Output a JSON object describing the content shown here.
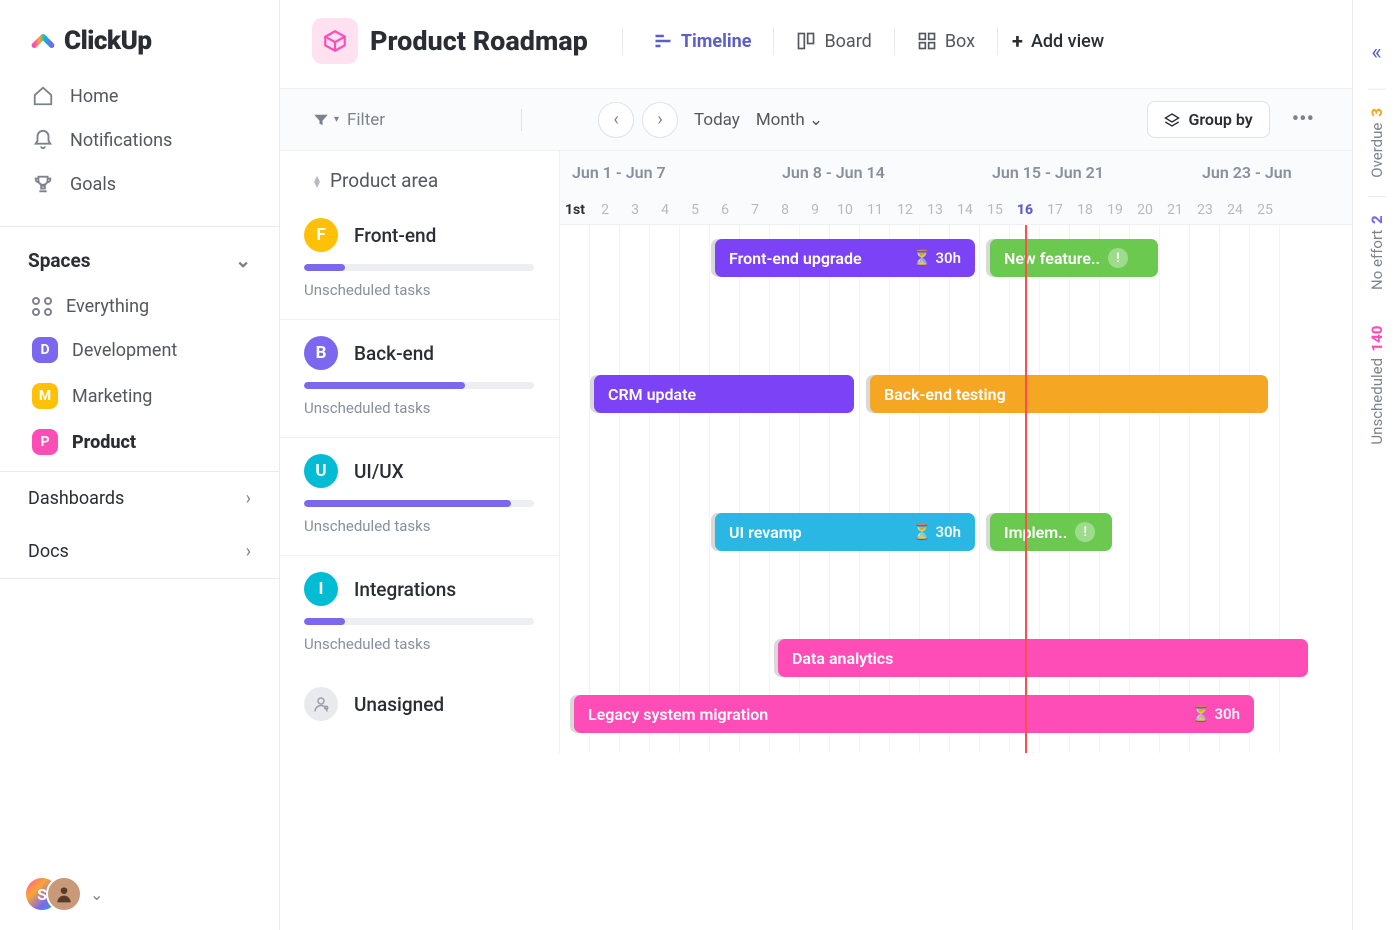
{
  "app": {
    "name": "ClickUp"
  },
  "page": {
    "title": "Product Roadmap"
  },
  "sidebar": {
    "nav": [
      "Home",
      "Notifications",
      "Goals"
    ],
    "spaces_label": "Spaces",
    "everything": "Everything",
    "spaces": [
      {
        "letter": "D",
        "label": "Development",
        "color": "#7b68ee"
      },
      {
        "letter": "M",
        "label": "Marketing",
        "color": "#ffc107"
      },
      {
        "letter": "P",
        "label": "Product",
        "color": "#ff4db8",
        "active": true
      }
    ],
    "dashboards": "Dashboards",
    "docs": "Docs",
    "user_initial": "S"
  },
  "views": {
    "timeline": "Timeline",
    "board": "Board",
    "box": "Box",
    "add": "Add view"
  },
  "toolbar": {
    "filter": "Filter",
    "today": "Today",
    "scale": "Month",
    "groupby": "Group by"
  },
  "calendar": {
    "group_column": "Product area",
    "weeks": [
      "Jun 1 - Jun 7",
      "Jun 8 - Jun 14",
      "Jun 15 - Jun 21",
      "Jun 23 - Jun"
    ],
    "days": [
      "1st",
      "2",
      "3",
      "4",
      "5",
      "6",
      "7",
      "8",
      "9",
      "10",
      "11",
      "12",
      "13",
      "14",
      "15",
      "16",
      "17",
      "18",
      "19",
      "20",
      "21",
      "23",
      "24",
      "25"
    ],
    "today_index": 15,
    "first_index": 0,
    "day_width": 30
  },
  "groups": [
    {
      "letter": "F",
      "label": "Front-end",
      "color": "#ffc107",
      "progress": 18,
      "sub": "Unscheduled tasks"
    },
    {
      "letter": "B",
      "label": "Back-end",
      "color": "#7b68ee",
      "progress": 70,
      "sub": "Unscheduled tasks"
    },
    {
      "letter": "U",
      "label": "UI/UX",
      "color": "#02bcd4",
      "progress": 90,
      "sub": "Unscheduled tasks"
    },
    {
      "letter": "I",
      "label": "Integrations",
      "color": "#02bcd4",
      "progress": 18,
      "sub": "Unscheduled tasks"
    },
    {
      "letter": "",
      "label": "Unasigned",
      "color": "#e8eaed",
      "progress": null,
      "sub": ""
    }
  ],
  "bars": {
    "frontend_upgrade": {
      "label": "Front-end upgrade",
      "hours": "30h",
      "color": "#7b42f6"
    },
    "new_feature": {
      "label": "New feature..",
      "color": "#6bc950",
      "alert": true
    },
    "crm_update": {
      "label": "CRM update",
      "color": "#7b42f6"
    },
    "backend_testing": {
      "label": "Back-end testing",
      "color": "#f5a623"
    },
    "ui_revamp": {
      "label": "UI revamp",
      "hours": "30h",
      "color": "#2ab7e3"
    },
    "implem": {
      "label": "Implem..",
      "color": "#6bc950",
      "alert": true
    },
    "data_analytics": {
      "label": "Data analytics",
      "color": "#ff4db8"
    },
    "legacy_migration": {
      "label": "Legacy system migration",
      "hours": "30h",
      "color": "#ff4db8"
    }
  },
  "rightbar": {
    "overdue": {
      "n": "3",
      "label": "Overdue",
      "color": "#f5a623"
    },
    "noeffort": {
      "n": "2",
      "label": "No effort",
      "color": "#7b68ee"
    },
    "unscheduled": {
      "n": "140",
      "label": "Unscheduled",
      "color": "#ff4db8"
    }
  }
}
